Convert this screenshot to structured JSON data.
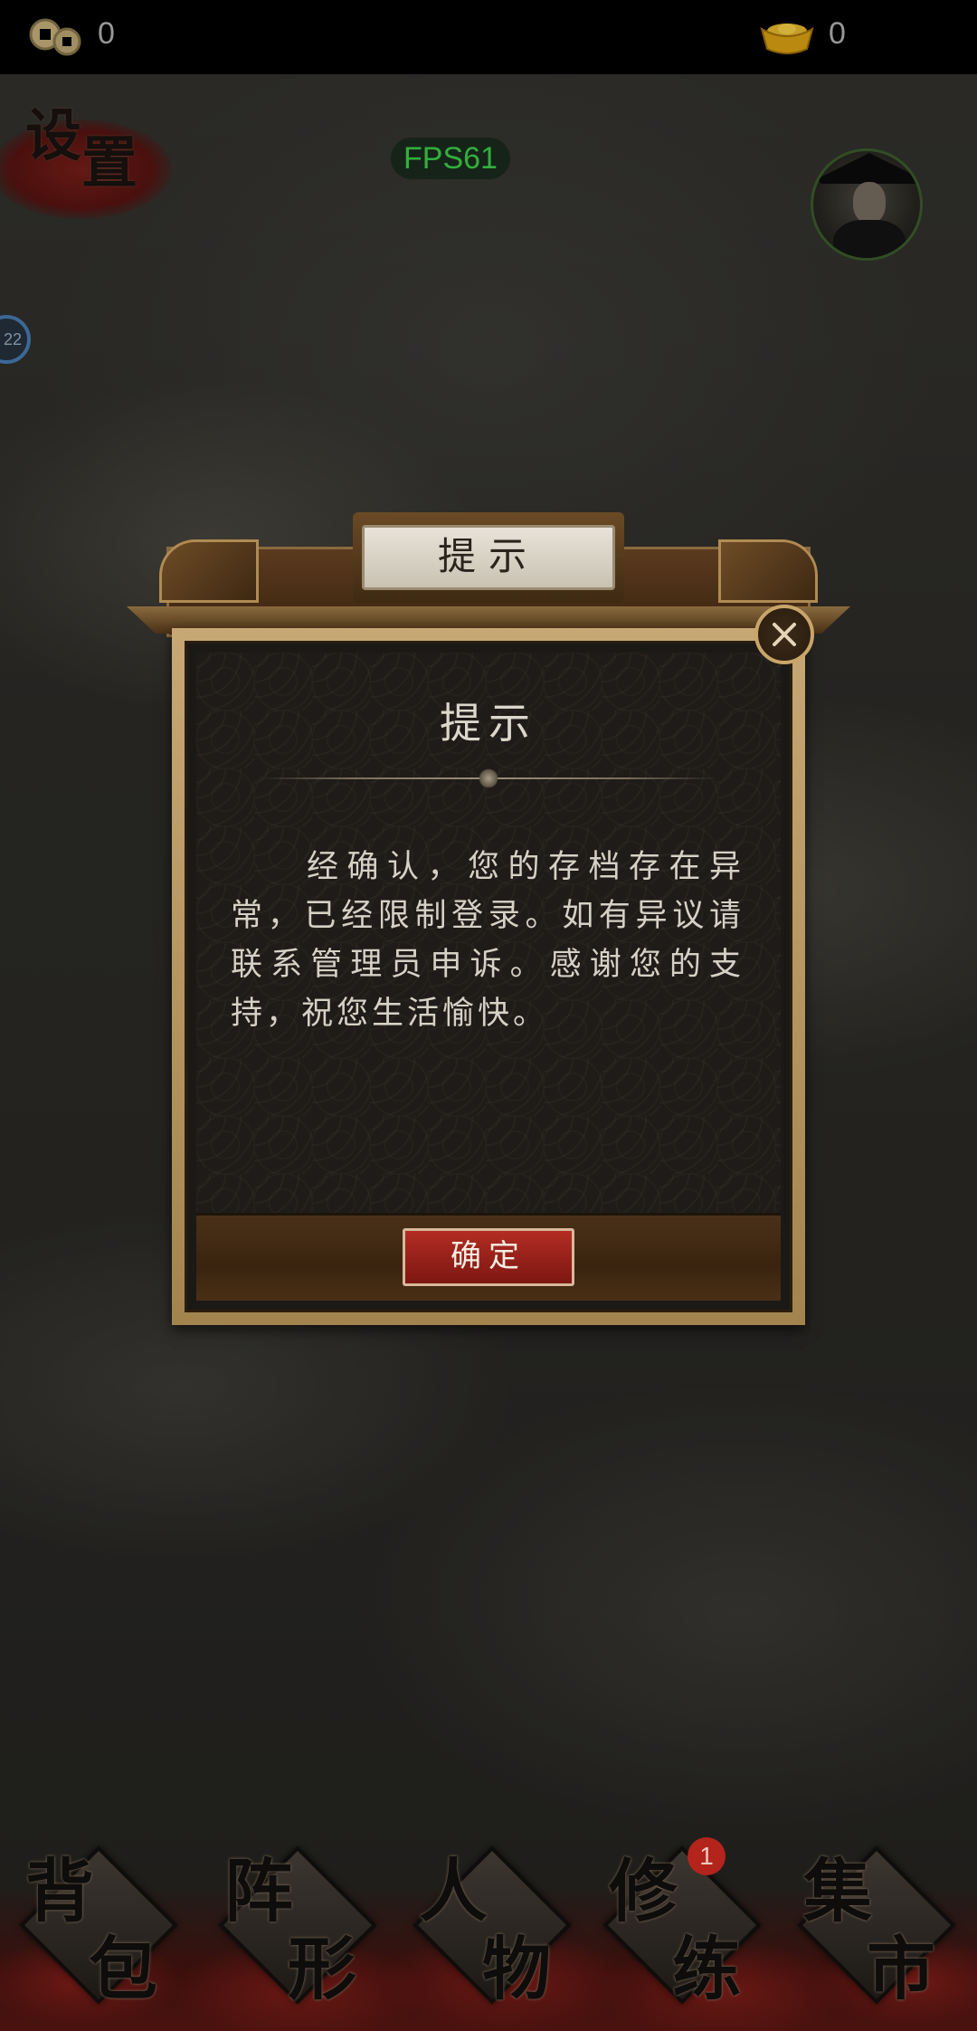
{
  "topbar": {
    "coins": "0",
    "ingots": "0"
  },
  "hud": {
    "settings_label_1": "设",
    "settings_label_2": "置",
    "fps": "FPS61",
    "side_badge": "22"
  },
  "dialog": {
    "title": "提示",
    "heading": "提示",
    "message": "经确认，您的存档存在异常，已经限制登录。如有异议请联系管理员申诉。感谢您的支持，祝您生活愉快。",
    "confirm_label": "确定"
  },
  "nav": {
    "items": [
      {
        "c1": "背",
        "c2": "包"
      },
      {
        "c1": "阵",
        "c2": "形"
      },
      {
        "c1": "人",
        "c2": "物"
      },
      {
        "c1": "修",
        "c2": "练"
      },
      {
        "c1": "集",
        "c2": "市"
      }
    ],
    "badge": "1"
  },
  "colors": {
    "fps_green": "#3ed64a",
    "button_red": "#b32c22",
    "frame_gold": "#c7a874"
  }
}
